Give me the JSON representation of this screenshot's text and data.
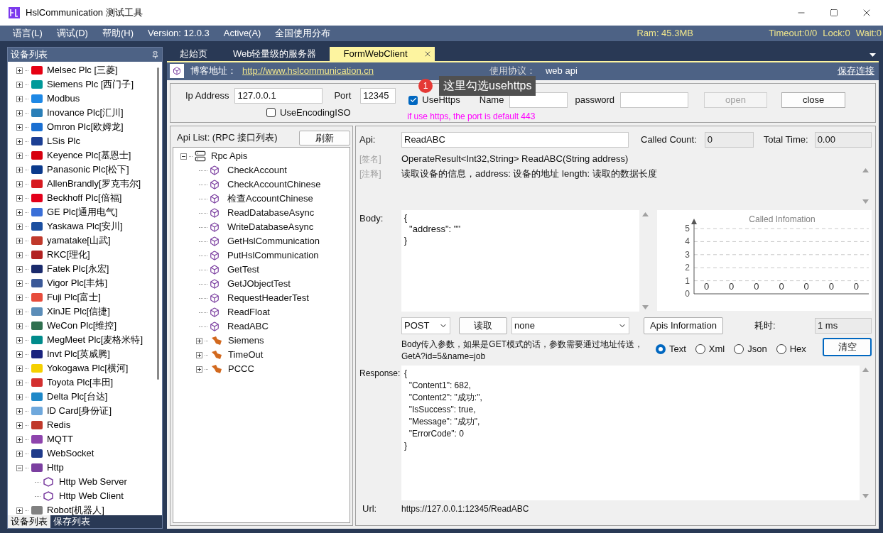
{
  "window": {
    "title": "HslCommunication 测试工具"
  },
  "menu": [
    "语言(L)",
    "调试(D)",
    "帮助(H)",
    "Version: 12.0.3",
    "Active(A)",
    "全国使用分布"
  ],
  "status": {
    "ram": "Ram: 45.3MB",
    "items": [
      "Timeout:0/0",
      "Lock:0",
      "Wait:0"
    ]
  },
  "device_panel": {
    "title": "设备列表",
    "tree": [
      {
        "label": "Melsec Plc [三菱]",
        "color": "#e60012",
        "expanded": false
      },
      {
        "label": "Siemens Plc [西门子]",
        "color": "#009999",
        "expanded": false
      },
      {
        "label": "Modbus",
        "color": "#1e88e5",
        "expanded": false
      },
      {
        "label": "Inovance Plc[汇川]",
        "color": "#2a7fb8",
        "expanded": false
      },
      {
        "label": "Omron Plc[欧姆龙]",
        "color": "#1a6fd1",
        "expanded": false
      },
      {
        "label": "LSis Plc",
        "color": "#1c3f94",
        "expanded": false
      },
      {
        "label": "Keyence Plc[基恩士]",
        "color": "#d7000f",
        "expanded": false
      },
      {
        "label": "Panasonic Plc[松下]",
        "color": "#0b3a8c",
        "expanded": false
      },
      {
        "label": "AllenBrandly[罗克韦尔]",
        "color": "#d71920",
        "expanded": false
      },
      {
        "label": "Beckhoff Plc[倍福]",
        "color": "#e3001b",
        "expanded": false
      },
      {
        "label": "GE Plc[通用电气]",
        "color": "#3a6fd8",
        "expanded": false
      },
      {
        "label": "Yaskawa Plc[安川]",
        "color": "#1b4fa0",
        "expanded": false
      },
      {
        "label": "yamatake[山武]",
        "color": "#c0392b",
        "expanded": false
      },
      {
        "label": "RKC[理化]",
        "color": "#b22222",
        "expanded": false
      },
      {
        "label": "Fatek Plc[永宏]",
        "color": "#1a2a6c",
        "expanded": false
      },
      {
        "label": "Vigor Plc[丰炜]",
        "color": "#3b5998",
        "expanded": false
      },
      {
        "label": "Fuji Plc[富士]",
        "color": "#e74c3c",
        "expanded": false
      },
      {
        "label": "XinJE Plc[信捷]",
        "color": "#5b8db8",
        "expanded": false
      },
      {
        "label": "WeCon Plc[维控]",
        "color": "#2f6f4f",
        "expanded": false
      },
      {
        "label": "MegMeet Plc[麦格米特]",
        "color": "#008b8b",
        "expanded": false
      },
      {
        "label": "Invt Plc[英威腾]",
        "color": "#1a237e",
        "expanded": false
      },
      {
        "label": "Yokogawa Plc[横河]",
        "color": "#f5d000",
        "expanded": false
      },
      {
        "label": "Toyota Plc[丰田]",
        "color": "#d32f2f",
        "expanded": false
      },
      {
        "label": "Delta Plc[台达]",
        "color": "#1e88c8",
        "expanded": false
      },
      {
        "label": "ID Card[身份证]",
        "color": "#6fa8dc",
        "expanded": false
      },
      {
        "label": "Redis",
        "color": "#c0392b",
        "expanded": false
      },
      {
        "label": "MQTT",
        "color": "#8e44ad",
        "expanded": false
      },
      {
        "label": "WebSocket",
        "color": "#1e3a8a",
        "expanded": false
      },
      {
        "label": "Http",
        "color": "#7b3fa0",
        "expanded": true,
        "children": [
          {
            "label": "Http Web Server",
            "color": "#7b3fa0"
          },
          {
            "label": "Http Web Client",
            "color": "#7b3fa0"
          }
        ]
      },
      {
        "label": "Robot[机器人]",
        "color": "#808080",
        "expanded": false
      }
    ],
    "tabs": [
      {
        "label": "设备列表",
        "selected": true
      },
      {
        "label": "保存列表",
        "selected": false
      }
    ]
  },
  "doc_tabs": [
    {
      "label": "起始页",
      "selected": false
    },
    {
      "label": "Web轻量级的服务器",
      "selected": false
    },
    {
      "label": "FormWebClient",
      "selected": true
    }
  ],
  "blog_bar": {
    "label": "博客地址：",
    "link": "http://www.hslcommunication.cn",
    "protocol_label": "使用协议：",
    "protocol": "web api",
    "save_link": "保存连接"
  },
  "tooltip": {
    "badge": "1",
    "text": "这里勾选usehttps"
  },
  "connection": {
    "ip_label": "Ip Address",
    "ip": "127.0.0.1",
    "port_label": "Port",
    "port": "12345",
    "use_encoding_iso": {
      "label": "UseEncodingISO",
      "checked": false
    },
    "use_https": {
      "label": "UseHttps",
      "checked": true
    },
    "name_label": "Name",
    "password_label": "password",
    "open": {
      "label": "open",
      "disabled": true
    },
    "close": {
      "label": "close",
      "disabled": false
    },
    "note": "if use https, the port is default 443"
  },
  "api_list": {
    "title": "Api List: (RPC 接口列表)",
    "refresh": "刷新",
    "tree": [
      {
        "label": "Rpc Apis",
        "kind": "server",
        "expanded": true,
        "children": [
          {
            "label": "CheckAccount",
            "kind": "method"
          },
          {
            "label": "CheckAccountChinese",
            "kind": "method"
          },
          {
            "label": "检查AccountChinese",
            "kind": "method"
          },
          {
            "label": "ReadDatabaseAsync",
            "kind": "method"
          },
          {
            "label": "WriteDatabaseAsync",
            "kind": "method"
          },
          {
            "label": "GetHslCommunication",
            "kind": "method"
          },
          {
            "label": "PutHslCommunication",
            "kind": "method"
          },
          {
            "label": "GetTest",
            "kind": "method"
          },
          {
            "label": "GetJObjectTest",
            "kind": "method"
          },
          {
            "label": "RequestHeaderTest",
            "kind": "method"
          },
          {
            "label": "ReadFloat",
            "kind": "method"
          },
          {
            "label": "ReadABC",
            "kind": "method"
          }
        ]
      },
      {
        "label": "Siemens",
        "kind": "group",
        "expanded": false
      },
      {
        "label": "TimeOut",
        "kind": "group",
        "expanded": false
      },
      {
        "label": "PCCC",
        "kind": "group",
        "expanded": false
      }
    ]
  },
  "api_detail": {
    "api_label": "Api:",
    "api": "ReadABC",
    "count_label": "Called Count:",
    "count": "0",
    "time_label": "Total Time:",
    "time": "0.00",
    "signature_label": "[签名]",
    "signature": "OperateResult<Int32,String> ReadABC(String address)",
    "comment_label": "[注释]",
    "comment": "读取设备的信息，address: 设备的地址 length: 读取的数据长度",
    "body_label": "Body:",
    "body": "{\n  \"address\": \"\"\n}",
    "chart_data": {
      "type": "bar",
      "title": "Called Infomation",
      "values": [
        0,
        0,
        0,
        0,
        0,
        0,
        0
      ],
      "ylim": [
        0,
        5
      ],
      "yticks": [
        0,
        1,
        2,
        3,
        4,
        5
      ],
      "grid": true,
      "data_labels": true
    },
    "method": "POST",
    "read": "读取",
    "content_type": "none",
    "apis_info": "Apis Information",
    "elapsed_label": "耗时:",
    "elapsed": "1 ms",
    "hint": [
      "Body传入参数，如果是GET模式的话，参数需要通过地址传送，",
      "GetA?id=5&name=job"
    ],
    "formats": [
      {
        "label": "Text",
        "selected": true
      },
      {
        "label": "Xml",
        "selected": false
      },
      {
        "label": "Json",
        "selected": false
      },
      {
        "label": "Hex",
        "selected": false
      }
    ],
    "clear": "清空",
    "response_label": "Response:",
    "response": "{\n  \"Content1\": 682,\n  \"Content2\": \"成功:\",\n  \"IsSuccess\": true,\n  \"Message\": \"成功\",\n  \"ErrorCode\": 0\n}",
    "url_label": "Url:",
    "url": "https://127.0.0.1:12345/ReadABC"
  }
}
